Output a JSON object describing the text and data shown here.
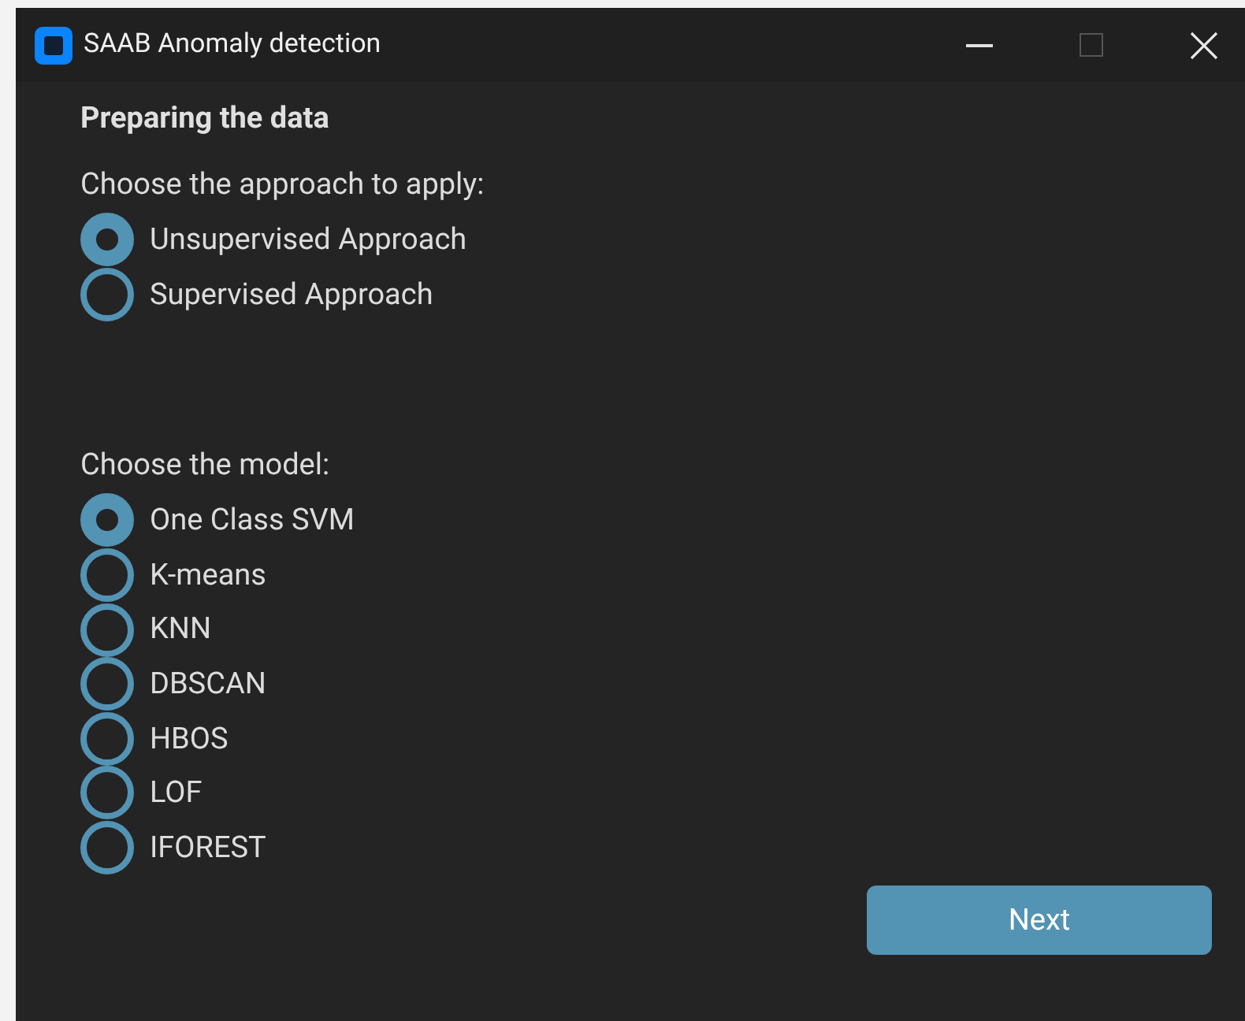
{
  "window": {
    "title": "SAAB Anomaly detection"
  },
  "heading": "Preparing the data",
  "approach": {
    "label": "Choose the approach to apply:",
    "options": [
      {
        "label": "Unsupervised Approach",
        "selected": true
      },
      {
        "label": "Supervised Approach",
        "selected": false
      }
    ]
  },
  "model": {
    "label": "Choose the model:",
    "options": [
      {
        "label": "One Class SVM",
        "selected": true
      },
      {
        "label": "K-means",
        "selected": false
      },
      {
        "label": "KNN",
        "selected": false
      },
      {
        "label": "DBSCAN",
        "selected": false
      },
      {
        "label": "HBOS",
        "selected": false
      },
      {
        "label": "LOF",
        "selected": false
      },
      {
        "label": "IFOREST",
        "selected": false
      }
    ]
  },
  "next_button": "Next"
}
